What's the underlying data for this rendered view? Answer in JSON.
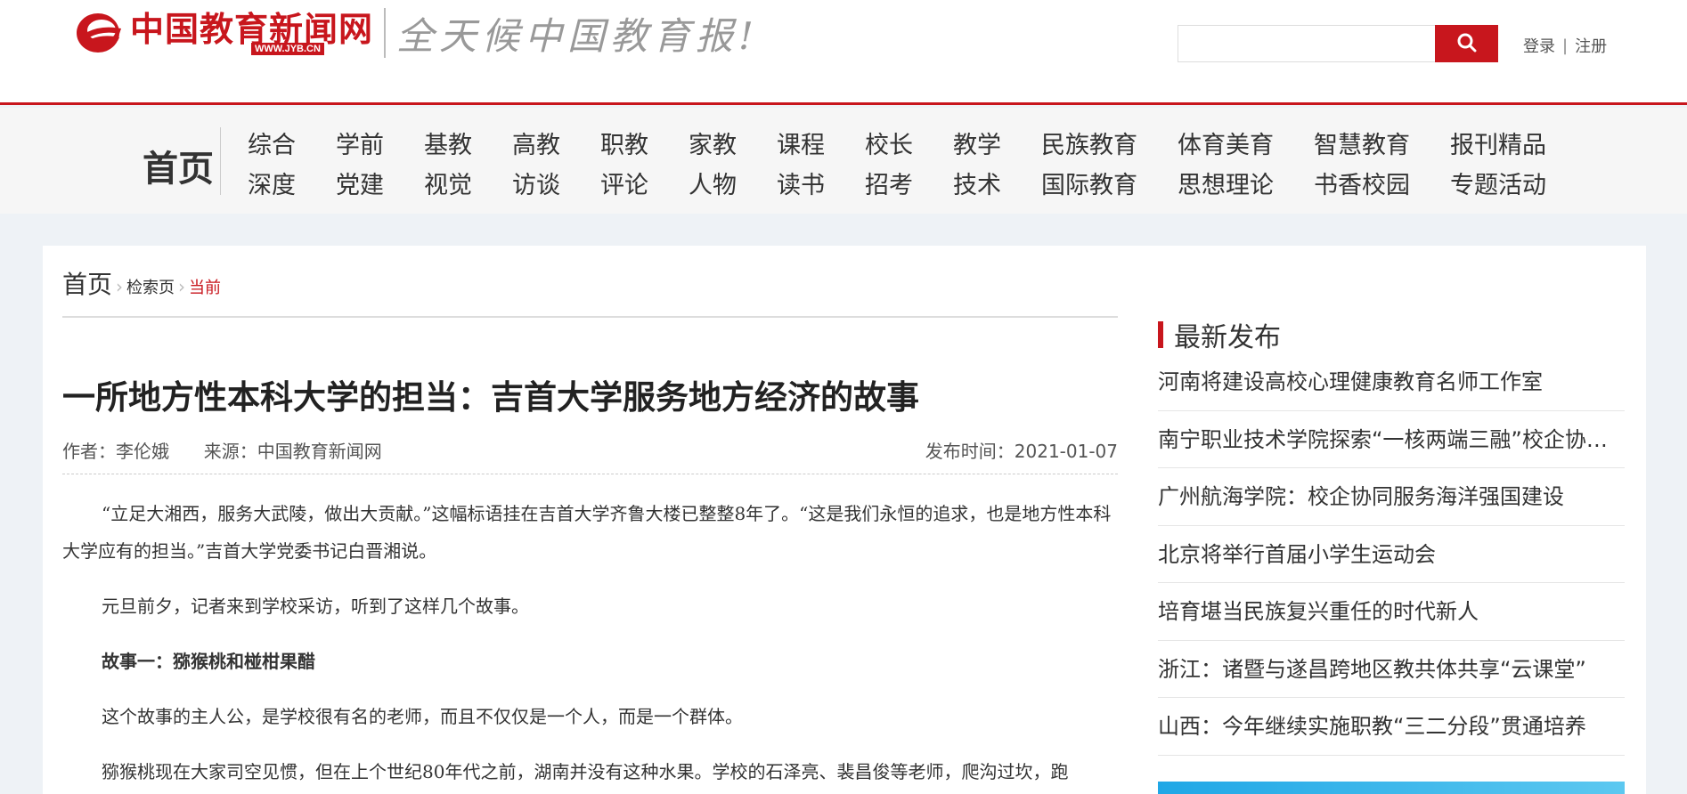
{
  "header": {
    "logo_text": "中国教育新闻网",
    "logo_url": "WWW.JYB.CN",
    "slogan": "全天候中国教育报!",
    "search": {
      "value": "",
      "placeholder": ""
    },
    "login": "登录",
    "separator": "|",
    "register": "注册"
  },
  "nav": {
    "home": "首页",
    "row1": [
      "综合",
      "学前",
      "基教",
      "高教",
      "职教",
      "家教",
      "课程",
      "校长",
      "教学",
      "民族教育",
      "体育美育",
      "智慧教育",
      "报刊精品"
    ],
    "row2": [
      "深度",
      "党建",
      "视觉",
      "访谈",
      "评论",
      "人物",
      "读书",
      "招考",
      "技术",
      "国际教育",
      "思想理论",
      "书香校园",
      "专题活动"
    ]
  },
  "breadcrumb": {
    "home": "首页",
    "search": "检索页",
    "current": "当前",
    "arrow": "›"
  },
  "article": {
    "title": "一所地方性本科大学的担当：吉首大学服务地方经济的故事",
    "author_label": "作者：",
    "author": "李伦娥",
    "source_label": "来源：",
    "source": "中国教育新闻网",
    "date_label": "发布时间：",
    "date": "2021-01-07",
    "paragraphs": [
      "“立足大湘西，服务大武陵，做出大贡献。”这幅标语挂在吉首大学齐鲁大楼已整整8年了。“这是我们永恒的追求，也是地方性本科大学应有的担当。”吉首大学党委书记白晋湘说。",
      "元旦前夕，记者来到学校采访，听到了这样几个故事。",
      "故事一：猕猴桃和椪柑果醋",
      "这个故事的主人公，是学校很有名的老师，而且不仅仅是一个人，而是一个群体。",
      "猕猴桃现在大家司空见惯，但在上个世纪80年代之前，湖南并没有这种水果。学校的石泽亮、裴昌俊等老师，爬沟过坎，跑"
    ]
  },
  "sidebar": {
    "title": "最新发布",
    "items": [
      "河南将建设高校心理健康教育名师工作室",
      "南宁职业技术学院探索“一核两端三融”校企协同育人",
      "广州航海学院：校企协同服务海洋强国建设",
      "北京将举行首届小学生运动会",
      "培育堪当民族复兴重任的时代新人",
      "浙江：诸暨与遂昌跨地区教共体共享“云课堂”",
      "山西：今年继续实施职教“三二分段”贯通培养"
    ]
  },
  "colors": {
    "brand_red": "#c8161d",
    "banner_blue": "#20a7e6"
  },
  "icons": {
    "logo": "jyb-logo-icon",
    "search": "search-icon"
  }
}
